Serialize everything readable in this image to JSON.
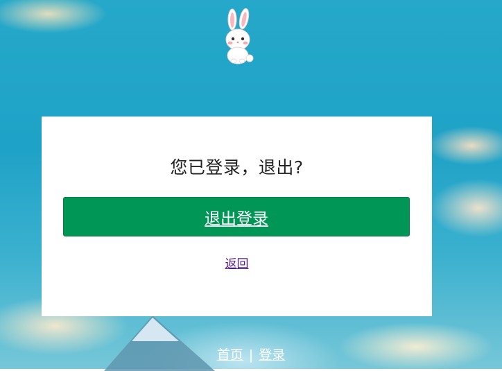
{
  "card": {
    "title": "您已登录，退出?",
    "logout_label": "退出登录",
    "back_label": "返回"
  },
  "footer": {
    "home_label": "首页",
    "separator": "|",
    "login_label": "登录"
  },
  "colors": {
    "primary_button": "#009656",
    "link_visited": "#551a8b",
    "sky": "#1ea2c7"
  },
  "icons": {
    "logo": "rabbit-logo-icon"
  }
}
